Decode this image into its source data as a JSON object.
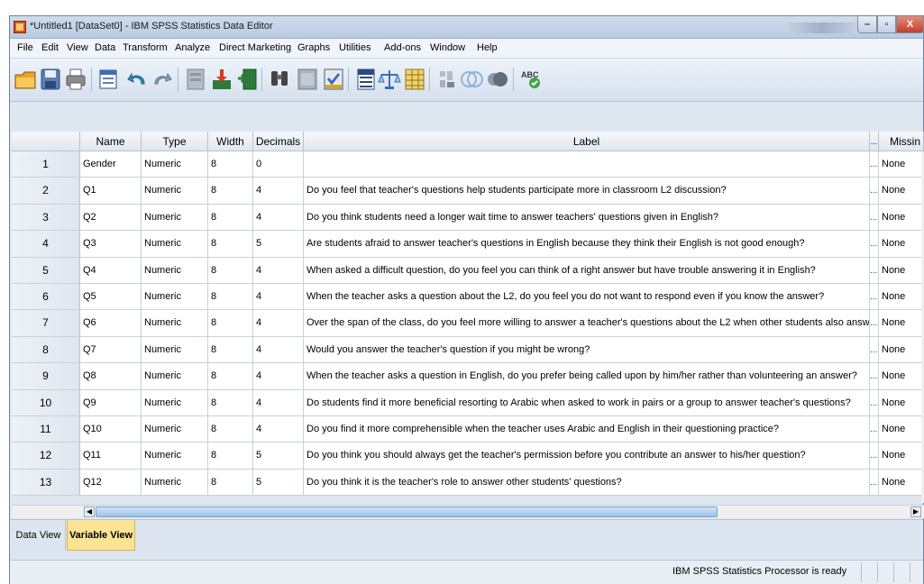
{
  "window": {
    "title": "*Untitled1 [DataSet0] - IBM SPSS Statistics Data Editor",
    "min_glyph": "–",
    "max_glyph": "▫",
    "close_glyph": "X"
  },
  "menu": [
    "File",
    "Edit",
    "View",
    "Data",
    "Transform",
    "Analyze",
    "Direct Marketing",
    "Graphs",
    "Utilities",
    "Add-ons",
    "Window",
    "Help"
  ],
  "toolbar": {
    "icons": [
      "open-folder-icon",
      "save-icon",
      "print-icon",
      "recall-dialog-icon",
      "undo-icon",
      "redo-icon",
      "goto-case-icon",
      "goto-variable-icon",
      "variables-icon",
      "find-icon",
      "insert-cases-icon",
      "insert-variable-icon",
      "split-file-icon",
      "weight-cases-icon",
      "select-cases-icon",
      "value-labels-icon",
      "use-sets-icon",
      "show-all-variables-icon",
      "spell-check-icon"
    ],
    "spell_label": "ABC"
  },
  "grid": {
    "columns": [
      "Name",
      "Type",
      "Width",
      "Decimals",
      "Label",
      "...",
      "Missin"
    ],
    "rows": [
      {
        "num": "1",
        "name": "Gender",
        "type": "Numeric",
        "width": "8",
        "decimals": "0",
        "label": "",
        "ell": "...",
        "missing": "None"
      },
      {
        "num": "2",
        "name": "Q1",
        "type": "Numeric",
        "width": "8",
        "decimals": "4",
        "label": "Do you feel that teacher's questions help students participate more in classroom L2 discussion?",
        "ell": "...",
        "missing": "None"
      },
      {
        "num": "3",
        "name": "Q2",
        "type": "Numeric",
        "width": "8",
        "decimals": "4",
        "label": "Do you think students need a longer wait time to answer teachers' questions given in English?",
        "ell": "...",
        "missing": "None"
      },
      {
        "num": "4",
        "name": "Q3",
        "type": "Numeric",
        "width": "8",
        "decimals": "5",
        "label": "Are students afraid to answer teacher's questions in English because they think their English is not good enough?",
        "ell": "...",
        "missing": "None"
      },
      {
        "num": "5",
        "name": "Q4",
        "type": "Numeric",
        "width": "8",
        "decimals": "4",
        "label": "When asked a difficult question, do you feel you can think of a right answer but have trouble answering it in English?",
        "ell": "...",
        "missing": "None"
      },
      {
        "num": "6",
        "name": "Q5",
        "type": "Numeric",
        "width": "8",
        "decimals": "4",
        "label": "When the teacher asks a question about the L2, do you feel you do not want to respond even if you know the answer?",
        "ell": "...",
        "missing": "None"
      },
      {
        "num": "7",
        "name": "Q6",
        "type": "Numeric",
        "width": "8",
        "decimals": "4",
        "label": "Over the span of the class, do you feel more willing to answer a teacher's questions about the L2 when other students also answer?",
        "ell": "...",
        "missing": "None"
      },
      {
        "num": "8",
        "name": "Q7",
        "type": "Numeric",
        "width": "8",
        "decimals": "4",
        "label": "Would you answer the teacher's question if you might be wrong?",
        "ell": "...",
        "missing": "None"
      },
      {
        "num": "9",
        "name": "Q8",
        "type": "Numeric",
        "width": "8",
        "decimals": "4",
        "label": "When the teacher asks a question in English, do you prefer being called upon by him/her rather than volunteering an answer?",
        "ell": "...",
        "missing": "None"
      },
      {
        "num": "10",
        "name": "Q9",
        "type": "Numeric",
        "width": "8",
        "decimals": "4",
        "label": "Do students find it more beneficial resorting to Arabic when asked to work in pairs or a group to answer teacher's questions?",
        "ell": "...",
        "missing": "None"
      },
      {
        "num": "11",
        "name": "Q10",
        "type": "Numeric",
        "width": "8",
        "decimals": "4",
        "label": "Do you find it more comprehensible when the teacher uses Arabic and English in their questioning practice?",
        "ell": "...",
        "missing": "None"
      },
      {
        "num": "12",
        "name": "Q11",
        "type": "Numeric",
        "width": "8",
        "decimals": "5",
        "label": "Do you think you should always get the teacher's permission before you contribute an answer to his/her question?",
        "ell": "...",
        "missing": "None"
      },
      {
        "num": "13",
        "name": "Q12",
        "type": "Numeric",
        "width": "8",
        "decimals": "5",
        "label": "Do you think it is the teacher's role to answer other students' questions?",
        "ell": "...",
        "missing": "None"
      }
    ]
  },
  "scroll": {
    "left_arrow": "◀",
    "right_arrow": "▶"
  },
  "tabs": {
    "data_view": "Data View",
    "variable_view": "Variable View"
  },
  "status": {
    "text": "IBM SPSS Statistics Processor is ready"
  }
}
